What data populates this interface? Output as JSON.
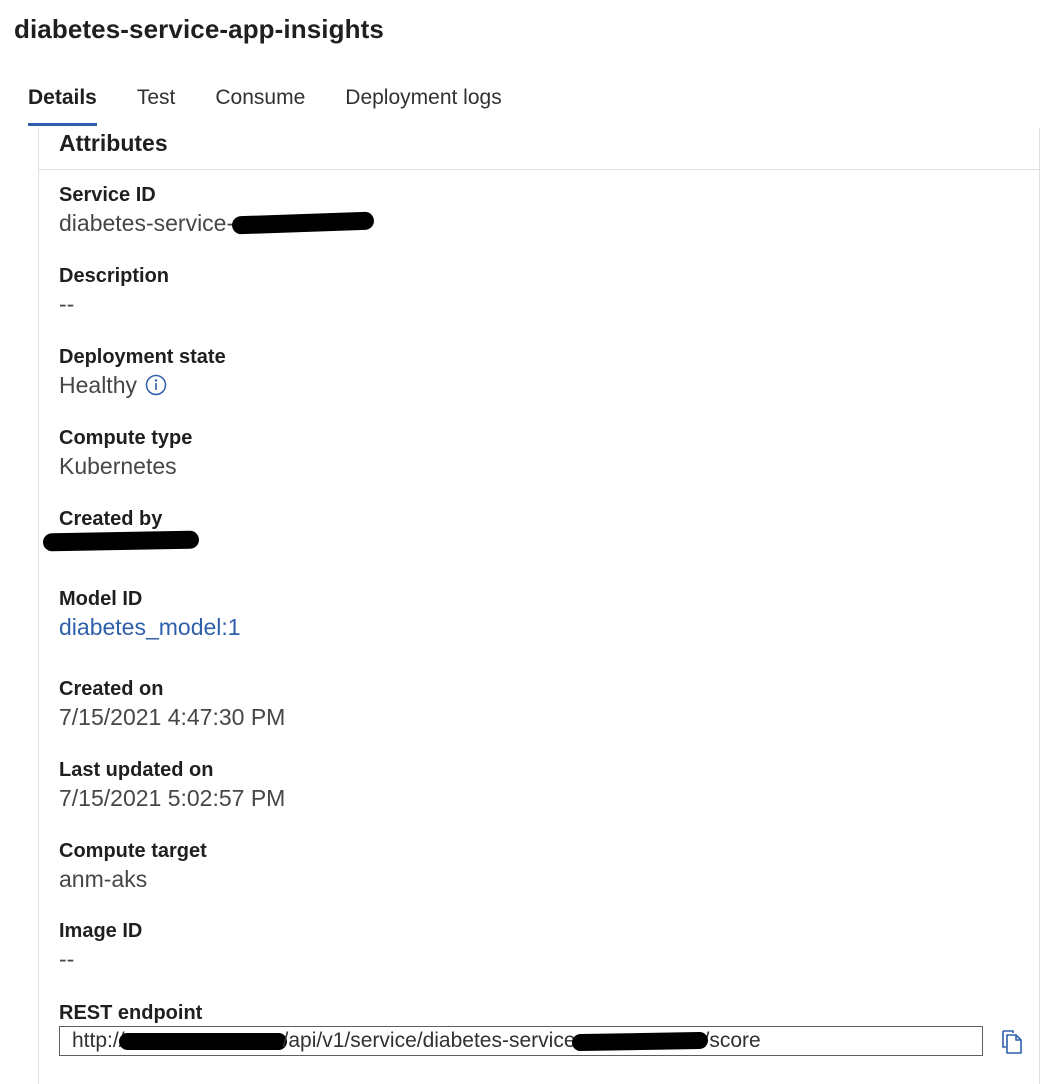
{
  "page": {
    "title": "diabetes-service-app-insights"
  },
  "tabs": [
    {
      "label": "Details",
      "active": true
    },
    {
      "label": "Test",
      "active": false
    },
    {
      "label": "Consume",
      "active": false
    },
    {
      "label": "Deployment logs",
      "active": false
    }
  ],
  "attributes": {
    "title": "Attributes",
    "service_id": {
      "label": "Service ID",
      "value_visible": "diabetes-service-"
    },
    "description": {
      "label": "Description",
      "value": "--"
    },
    "deployment_state": {
      "label": "Deployment state",
      "value": "Healthy",
      "icon": "info-icon"
    },
    "compute_type": {
      "label": "Compute type",
      "value": "Kubernetes"
    },
    "created_by": {
      "label": "Created by"
    },
    "model_id": {
      "label": "Model ID",
      "value": "diabetes_model:1"
    },
    "created_on": {
      "label": "Created on",
      "value": "7/15/2021 4:47:30 PM"
    },
    "last_updated_on": {
      "label": "Last updated on",
      "value": "7/15/2021 5:02:57 PM"
    },
    "compute_target": {
      "label": "Compute target",
      "value": "anm-aks"
    },
    "image_id": {
      "label": "Image ID",
      "value": "--"
    },
    "rest_endpoint": {
      "label": "REST endpoint",
      "prefix": "http://",
      "middle": "/api/v1/service/diabetes-service",
      "suffix": "/score",
      "icon": "copy-icon"
    }
  },
  "colors": {
    "accent": "#2f5faa",
    "border": "#e1dfdd",
    "redaction": "#000000"
  }
}
